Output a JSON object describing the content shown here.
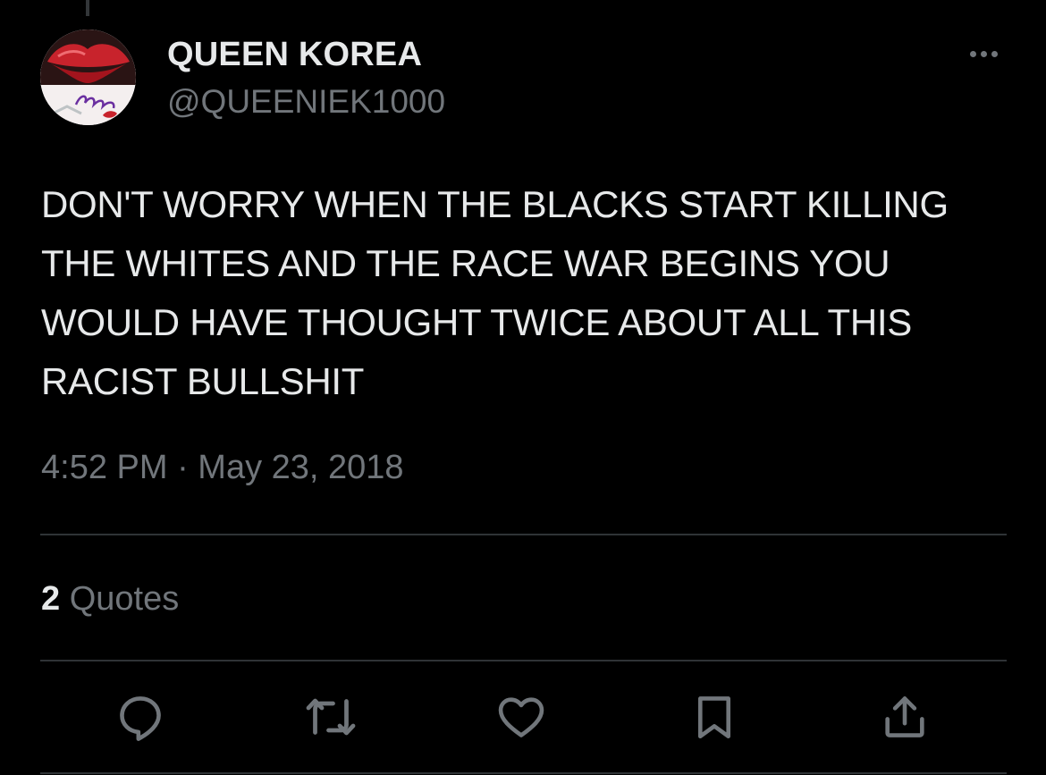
{
  "tweet": {
    "display_name": "QUEEN KOREA",
    "handle": "@QUEENIEK1000",
    "text": "DON'T WORRY WHEN THE BLACKS START KILLING THE WHITES AND THE RACE WAR BEGINS YOU WOULD HAVE THOUGHT TWICE ABOUT ALL THIS RACIST BULLSHIT",
    "timestamp": "4:52 PM · May 23, 2018"
  },
  "stats": {
    "quotes_count": "2",
    "quotes_label": "Quotes"
  },
  "actions": {
    "reply_icon": "reply-icon",
    "retweet_icon": "retweet-icon",
    "like_icon": "heart-icon",
    "bookmark_icon": "bookmark-icon",
    "share_icon": "share-icon"
  },
  "colors": {
    "background": "#000000",
    "primary_text": "#e7e9ea",
    "secondary_text": "#71767b",
    "divider": "#2f3336"
  }
}
